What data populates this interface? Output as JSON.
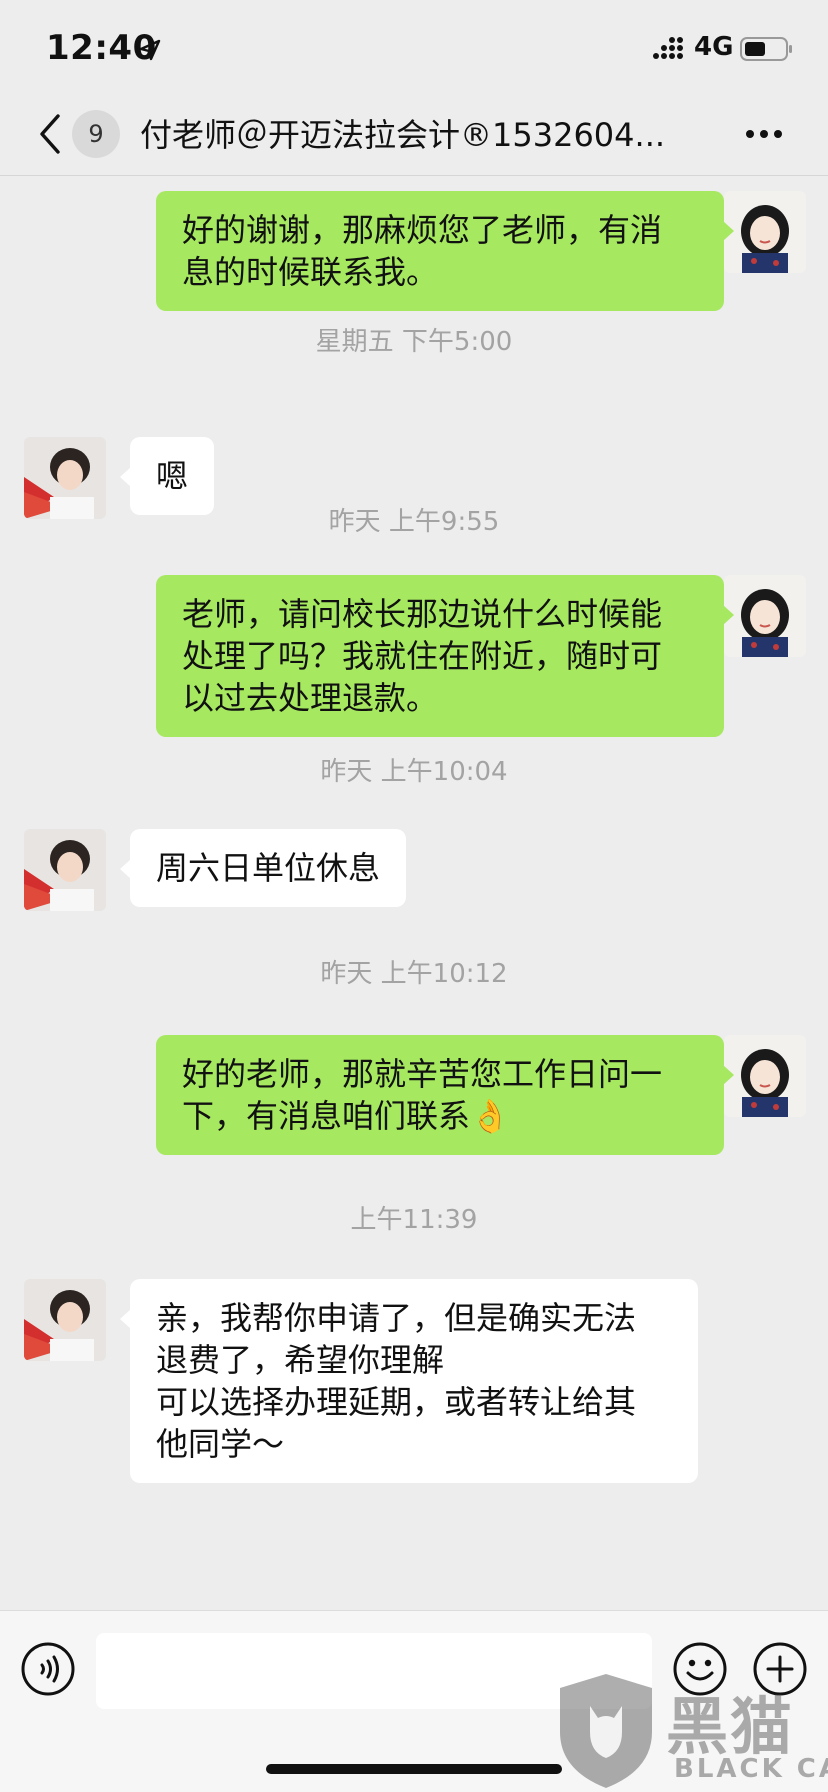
{
  "status_bar": {
    "time": "12:40",
    "network": "4G"
  },
  "nav": {
    "unread_count": "9",
    "title": "付老师＠开迈法拉会计®1532604..."
  },
  "messages": [
    {
      "sender": "self",
      "text": "好的谢谢，那麻烦您了老师，有消\n息的时候联系我。"
    },
    {
      "timestamp": "星期五 下午5:00"
    },
    {
      "sender": "other",
      "text": "嗯"
    },
    {
      "timestamp": "昨天 上午9:55"
    },
    {
      "sender": "self",
      "text": "老师，请问校长那边说什么时候能\n处理了吗？我就住在附近，随时可\n以过去处理退款。"
    },
    {
      "timestamp": "昨天 上午10:04"
    },
    {
      "sender": "other",
      "text": "周六日单位休息"
    },
    {
      "timestamp": "昨天 上午10:12"
    },
    {
      "sender": "self",
      "text": "好的老师，那就辛苦您工作日问一\n下，有消息咱们联系👌"
    },
    {
      "timestamp": "上午11:39"
    },
    {
      "sender": "other",
      "text": "亲，我帮你申请了，但是确实无法\n退费了，希望你理解\n可以选择办理延期，或者转让给其\n他同学～"
    }
  ],
  "input": {
    "value": ""
  },
  "watermark": {
    "cn": "黑猫",
    "en": "BLACK CAT"
  },
  "colors": {
    "self_bubble": "#a6e860",
    "other_bubble": "#ffffff",
    "background": "#ededed"
  }
}
